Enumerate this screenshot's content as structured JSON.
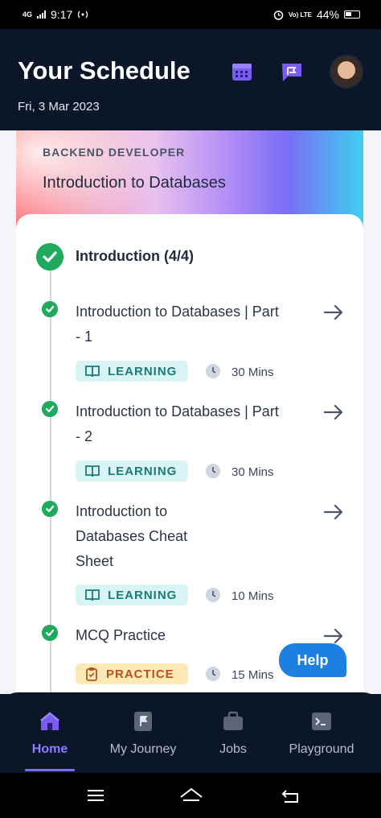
{
  "status_bar": {
    "network": "4G",
    "time": "9:17",
    "volte": "Vo) LTE",
    "battery": "44%"
  },
  "header": {
    "title": "Your Schedule",
    "date": "Fri, 3 Mar 2023",
    "icons": [
      "calendar-icon",
      "chat-flag-icon",
      "avatar"
    ]
  },
  "banner": {
    "track": "BACKEND DEVELOPER",
    "course": "Introduction to Databases"
  },
  "section": {
    "title": "Introduction (4/4)"
  },
  "items": [
    {
      "title": "Introduction to Databases | Part - 1",
      "tag": "LEARNING",
      "duration": "30 Mins"
    },
    {
      "title": "Introduction to Databases | Part - 2",
      "tag": "LEARNING",
      "duration": "30 Mins"
    },
    {
      "title": "Introduction to Databases Cheat Sheet",
      "tag": "LEARNING",
      "duration": "10 Mins"
    },
    {
      "title": "MCQ Practice",
      "tag": "PRACTICE",
      "duration": "15 Mins"
    }
  ],
  "help": "Help",
  "tabs": [
    {
      "label": "Home",
      "icon": "home-icon",
      "active": true
    },
    {
      "label": "My Journey",
      "icon": "journey-icon",
      "active": false
    },
    {
      "label": "Jobs",
      "icon": "briefcase-icon",
      "active": false
    },
    {
      "label": "Playground",
      "icon": "terminal-icon",
      "active": false
    }
  ],
  "colors": {
    "accent": "#8c7bff",
    "success": "#1faa5e",
    "help": "#1d7fe0",
    "bg": "#0b1628"
  }
}
